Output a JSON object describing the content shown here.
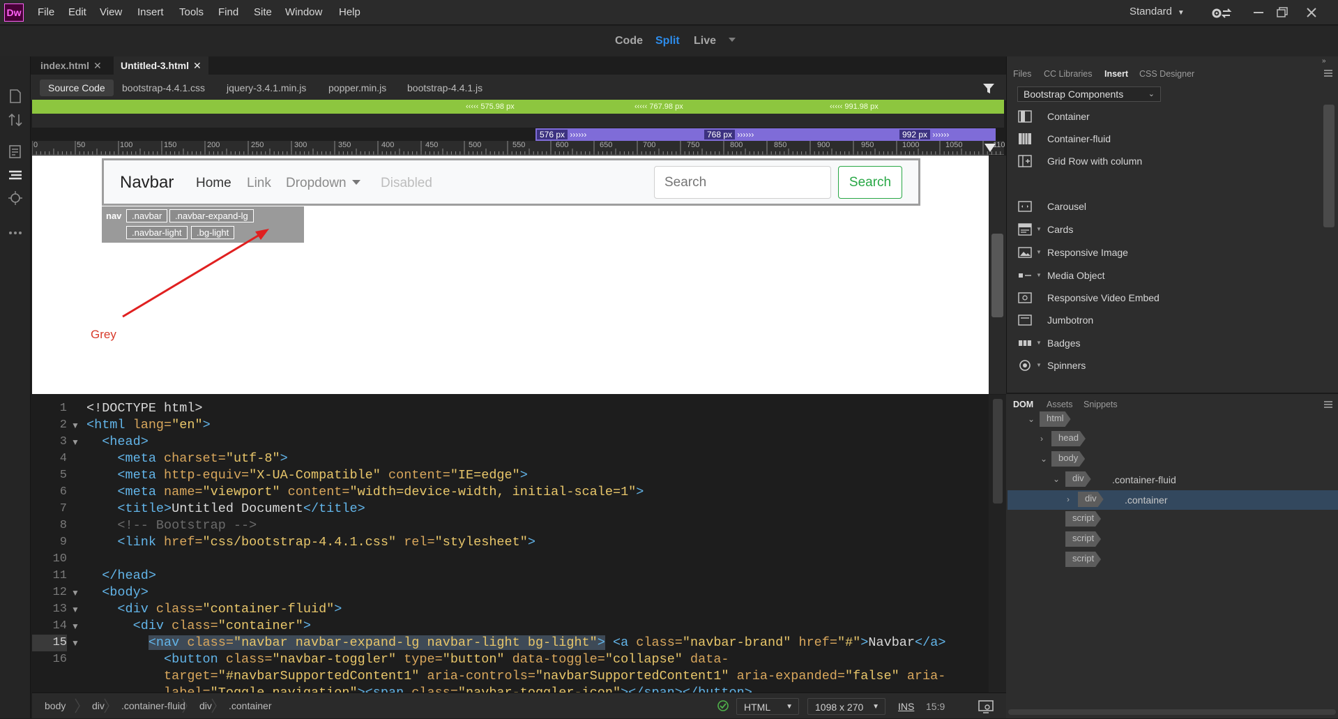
{
  "app": {
    "logo": "Dw"
  },
  "menu": [
    "File",
    "Edit",
    "View",
    "Insert",
    "Tools",
    "Find",
    "Site",
    "Window",
    "Help"
  ],
  "workspace": {
    "label": "Standard"
  },
  "view_switch": {
    "code": "Code",
    "split": "Split",
    "live": "Live"
  },
  "doc_tabs": [
    {
      "label": "index.html",
      "close": "✕"
    },
    {
      "label": "Untitled-3.html",
      "close": "✕"
    }
  ],
  "related_files": [
    "Source Code",
    "bootstrap-4.4.1.css",
    "jquery-3.4.1.min.js",
    "popper.min.js",
    "bootstrap-4.4.1.js"
  ],
  "media_queries": {
    "green": [
      "575.98",
      "767.98",
      "991.98"
    ],
    "blue": [
      "576",
      "768",
      "992"
    ],
    "unit": "px"
  },
  "ruler": {
    "labels": [
      "0",
      "50",
      "100",
      "150",
      "200",
      "250",
      "300",
      "350",
      "400",
      "450",
      "500",
      "550",
      "600",
      "650",
      "700",
      "750",
      "800",
      "850",
      "900",
      "950",
      "1000",
      "1050",
      "110"
    ]
  },
  "live_view": {
    "navbar": {
      "brand": "Navbar",
      "links": [
        "Home",
        "Link",
        "Dropdown",
        "Disabled"
      ],
      "search_placeholder": "Search",
      "search_button": "Search"
    },
    "tag_selector": {
      "tag": "nav",
      "classes": [
        ".navbar",
        ".navbar-expand-lg",
        ".navbar-light",
        ".bg-light"
      ]
    },
    "annotation": "Grey"
  },
  "code": {
    "line_numbers": [
      "1",
      "2",
      "3",
      "4",
      "5",
      "6",
      "7",
      "8",
      "9",
      "10",
      "11",
      "12",
      "13",
      "14",
      "15",
      "16"
    ],
    "current_line": "15",
    "lines": [
      [
        [
          "<!DOCTYPE html>",
          "p"
        ]
      ],
      [
        [
          "<html",
          "t"
        ],
        [
          " lang=",
          "a"
        ],
        [
          "\"en\"",
          "v"
        ],
        [
          ">",
          "t"
        ]
      ],
      [
        [
          "  <head>",
          "t"
        ]
      ],
      [
        [
          "    <meta",
          "t"
        ],
        [
          " charset=",
          "a"
        ],
        [
          "\"utf-8\"",
          "v"
        ],
        [
          ">",
          "t"
        ]
      ],
      [
        [
          "    <meta",
          "t"
        ],
        [
          " http-equiv=",
          "a"
        ],
        [
          "\"X-UA-Compatible\"",
          "v"
        ],
        [
          " content=",
          "a"
        ],
        [
          "\"IE=edge\"",
          "v"
        ],
        [
          ">",
          "t"
        ]
      ],
      [
        [
          "    <meta",
          "t"
        ],
        [
          " name=",
          "a"
        ],
        [
          "\"viewport\"",
          "v"
        ],
        [
          " content=",
          "a"
        ],
        [
          "\"width=device-width, initial-scale=1\"",
          "v"
        ],
        [
          ">",
          "t"
        ]
      ],
      [
        [
          "    <title>",
          "t"
        ],
        [
          "Untitled Document",
          "p"
        ],
        [
          "</title>",
          "t"
        ]
      ],
      [
        [
          "    <!-- Bootstrap -->",
          "c"
        ]
      ],
      [
        [
          "    <link",
          "t"
        ],
        [
          " href=",
          "a"
        ],
        [
          "\"css/bootstrap-4.4.1.css\"",
          "v"
        ],
        [
          " rel=",
          "a"
        ],
        [
          "\"stylesheet\"",
          "v"
        ],
        [
          ">",
          "t"
        ]
      ],
      [
        [
          "",
          "p"
        ]
      ],
      [
        [
          "  </head>",
          "t"
        ]
      ],
      [
        [
          "  <body>",
          "t"
        ]
      ],
      [
        [
          "    <div",
          "t"
        ],
        [
          " class=",
          "a"
        ],
        [
          "\"container-fluid\"",
          "v"
        ],
        [
          ">",
          "t"
        ]
      ],
      [
        [
          "      <div",
          "t"
        ],
        [
          " class=",
          "a"
        ],
        [
          "\"container\"",
          "v"
        ],
        [
          ">",
          "t"
        ]
      ],
      [
        [
          "        ",
          "p"
        ],
        [
          "<nav",
          "ts"
        ],
        [
          " class=",
          "as"
        ],
        [
          "\"navbar navbar-expand-lg navbar-light bg-light\"",
          "vs"
        ],
        [
          ">",
          "ts"
        ],
        [
          " <a",
          "t"
        ],
        [
          " class=",
          "a"
        ],
        [
          "\"navbar-brand\"",
          "v"
        ],
        [
          " href=",
          "a"
        ],
        [
          "\"#\"",
          "v"
        ],
        [
          ">",
          "t"
        ],
        [
          "Navbar",
          "p"
        ],
        [
          "</a>",
          "t"
        ]
      ],
      [
        [
          "          <button",
          "t"
        ],
        [
          " class=",
          "a"
        ],
        [
          "\"navbar-toggler\"",
          "v"
        ],
        [
          " type=",
          "a"
        ],
        [
          "\"button\"",
          "v"
        ],
        [
          " data-toggle=",
          "a"
        ],
        [
          "\"collapse\"",
          "v"
        ],
        [
          " data-",
          "a"
        ]
      ],
      [
        [
          "          target=",
          "a"
        ],
        [
          "\"#navbarSupportedContent1\"",
          "v"
        ],
        [
          " aria-controls=",
          "a"
        ],
        [
          "\"navbarSupportedContent1\"",
          "v"
        ],
        [
          " aria-expanded=",
          "a"
        ],
        [
          "\"false\"",
          "v"
        ],
        [
          " aria-",
          "a"
        ]
      ],
      [
        [
          "          label=",
          "a"
        ],
        [
          "\"Toggle navigation\"",
          "v"
        ],
        [
          "><span",
          "t"
        ],
        [
          " class=",
          "a"
        ],
        [
          "\"navbar-toggler-icon\"",
          "v"
        ],
        [
          "></span></button>",
          "t"
        ]
      ]
    ]
  },
  "status_bar": {
    "breadcrumbs": [
      "body",
      "div",
      ".container-fluid",
      "div",
      ".container"
    ],
    "doc_type": "HTML",
    "size": "1098 x 270",
    "mode": "INS",
    "position": "15:9"
  },
  "panel_tabs": [
    "Files",
    "CC Libraries",
    "Insert",
    "CSS Designer"
  ],
  "insert_panel": {
    "category": "Bootstrap Components",
    "items": [
      "Container",
      "Container-fluid",
      "Grid Row with column",
      "Carousel",
      "Cards",
      "Responsive Image",
      "Media Object",
      "Responsive Video Embed",
      "Jumbotron",
      "Badges",
      "Spinners"
    ]
  },
  "dom_tabs": [
    "DOM",
    "Assets",
    "Snippets"
  ],
  "dom_tree": {
    "html": "html",
    "head": "head",
    "body": "body",
    "div1": "div",
    "div1_class": ".container-fluid",
    "div2": "div",
    "div2_class": ".container",
    "scripts": [
      "script",
      "script",
      "script"
    ]
  },
  "colors": {
    "accent": "#2d8ceb",
    "media_query_green": "#8dc63f",
    "media_query_blue": "#7f6cd8",
    "logo": "#ff61f6",
    "annotation": "#d83a2a"
  }
}
